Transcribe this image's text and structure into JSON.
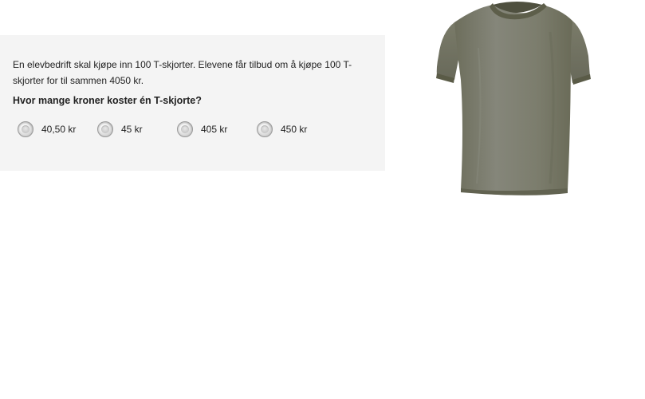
{
  "question": {
    "text": "En elevbedrift skal kjøpe inn 100 T-skjorter. Elevene får tilbud om å kjøpe 100 T-skjorter for til sammen 4050 kr.",
    "prompt": "Hvor mange kroner koster én T-skjorte?"
  },
  "options": [
    {
      "label": "40,50 kr",
      "selected": false
    },
    {
      "label": "45 kr",
      "selected": false
    },
    {
      "label": "405 kr",
      "selected": false
    },
    {
      "label": "450 kr",
      "selected": false
    }
  ],
  "image": {
    "icon": "tshirt-image",
    "colors": {
      "shirt": "#7f806e",
      "trim": "#5d5e4a",
      "panel": "#f4f4f4"
    }
  }
}
